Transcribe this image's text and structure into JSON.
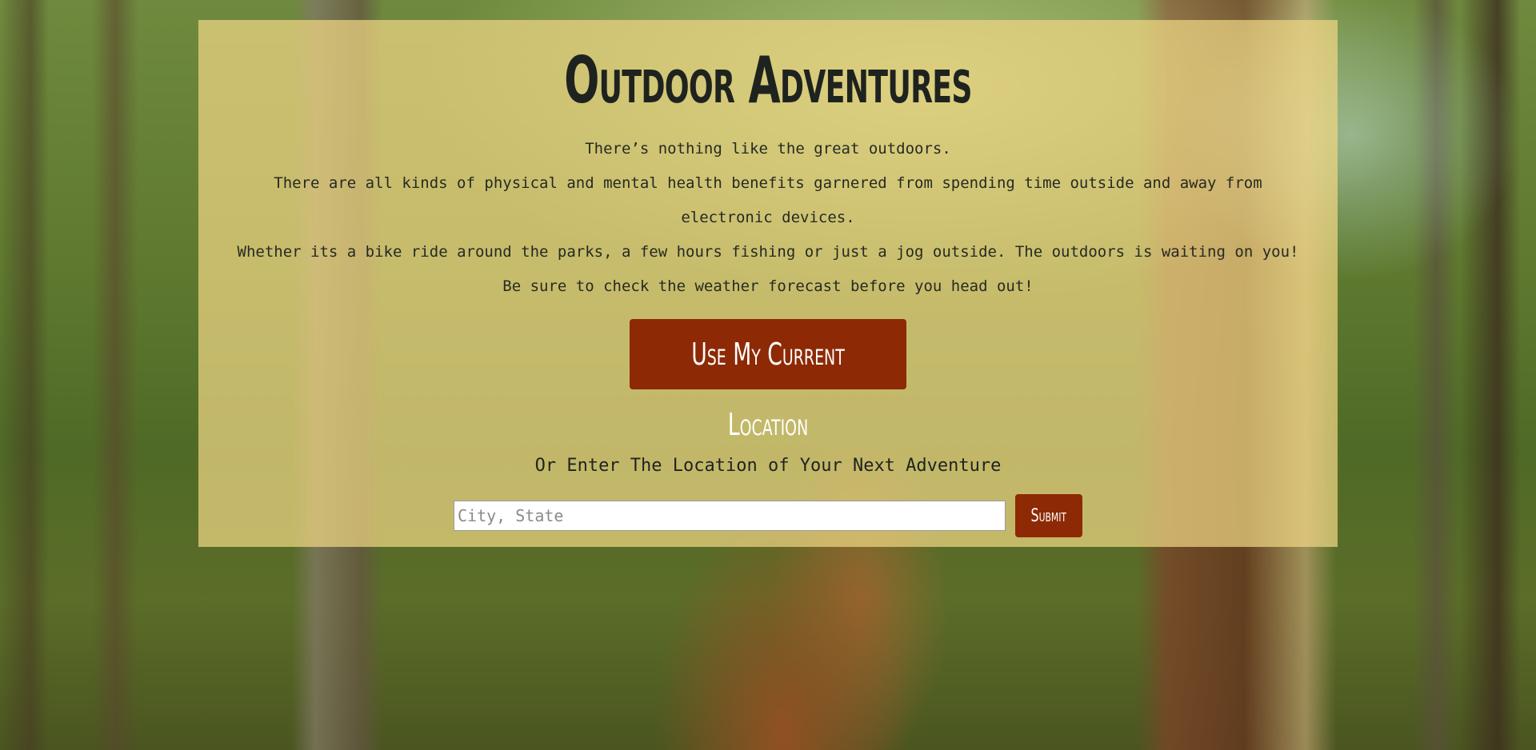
{
  "header": {
    "title": "Outdoor Adventures"
  },
  "intro": {
    "paragraphs": [
      "There’s nothing like the great outdoors.",
      "There are all kinds of physical and mental health benefits garnered from spending time outside and away from electronic devices.",
      "Whether its a bike ride around the parks, a few hours fishing or just a jog outside. The outdoors is waiting on you!",
      "Be sure to check the weather forecast before you head out!"
    ]
  },
  "location": {
    "current_location_label": "Use My Current Location",
    "or_label": "Or Enter The Location of Your Next Adventure",
    "input_placeholder": "City, State",
    "input_value": "",
    "submit_label": "Submit"
  },
  "colors": {
    "accent": "#8d2a05",
    "panel": "#eed684",
    "text": "#1f231f"
  }
}
